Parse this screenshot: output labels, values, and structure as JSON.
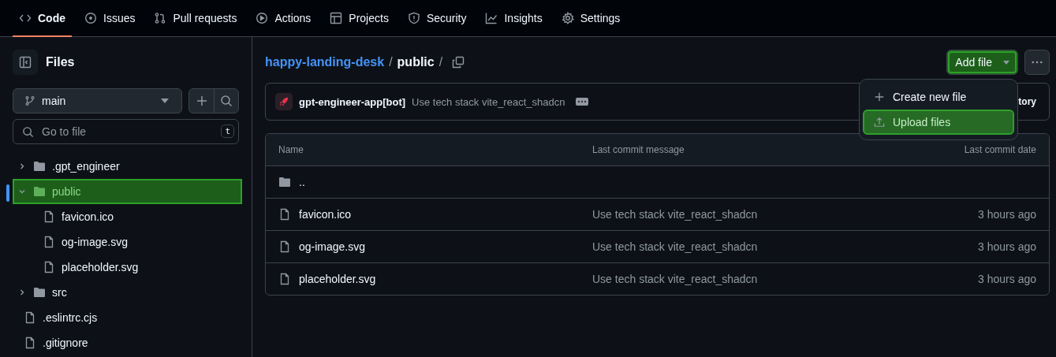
{
  "nav_tabs": [
    {
      "label": "Code",
      "selected": true
    },
    {
      "label": "Issues",
      "selected": false
    },
    {
      "label": "Pull requests",
      "selected": false
    },
    {
      "label": "Actions",
      "selected": false
    },
    {
      "label": "Projects",
      "selected": false
    },
    {
      "label": "Security",
      "selected": false
    },
    {
      "label": "Insights",
      "selected": false
    },
    {
      "label": "Settings",
      "selected": false
    }
  ],
  "sidebar": {
    "title": "Files",
    "branch": "main",
    "search": {
      "placeholder": "Go to file",
      "shortcut": "t"
    },
    "tree": [
      {
        "name": ".gpt_engineer",
        "kind": "folder",
        "expanded": false,
        "selected": false
      },
      {
        "name": "public",
        "kind": "folder",
        "expanded": true,
        "selected": true,
        "children": [
          {
            "name": "favicon.ico",
            "kind": "file",
            "selected": false
          },
          {
            "name": "og-image.svg",
            "kind": "file",
            "selected": false
          },
          {
            "name": "placeholder.svg",
            "kind": "file",
            "selected": false
          }
        ]
      },
      {
        "name": "src",
        "kind": "folder",
        "expanded": false,
        "selected": false
      },
      {
        "name": ".eslintrc.cjs",
        "kind": "file",
        "selected": false
      },
      {
        "name": ".gitignore",
        "kind": "file",
        "selected": false
      }
    ]
  },
  "breadcrumb": {
    "repo": "happy-landing-desk",
    "separator": "/",
    "path": "public",
    "trailing": "/"
  },
  "add_file_button": {
    "label": "Add file",
    "highlighted": true
  },
  "add_file_menu": [
    {
      "label": "Create new file",
      "highlighted": false
    },
    {
      "label": "Upload files",
      "highlighted": true
    }
  ],
  "commit": {
    "author": "gpt-engineer-app[bot]",
    "message": "Use tech stack vite_react_shadcn",
    "history_label": "tory"
  },
  "table": {
    "columns": [
      "Name",
      "Last commit message",
      "Last commit date"
    ],
    "parent_row": "..",
    "rows": [
      {
        "name": "favicon.ico",
        "message": "Use tech stack vite_react_shadcn",
        "date": "3 hours ago"
      },
      {
        "name": "og-image.svg",
        "message": "Use tech stack vite_react_shadcn",
        "date": "3 hours ago"
      },
      {
        "name": "placeholder.svg",
        "message": "Use tech stack vite_react_shadcn",
        "date": "3 hours ago"
      }
    ]
  }
}
